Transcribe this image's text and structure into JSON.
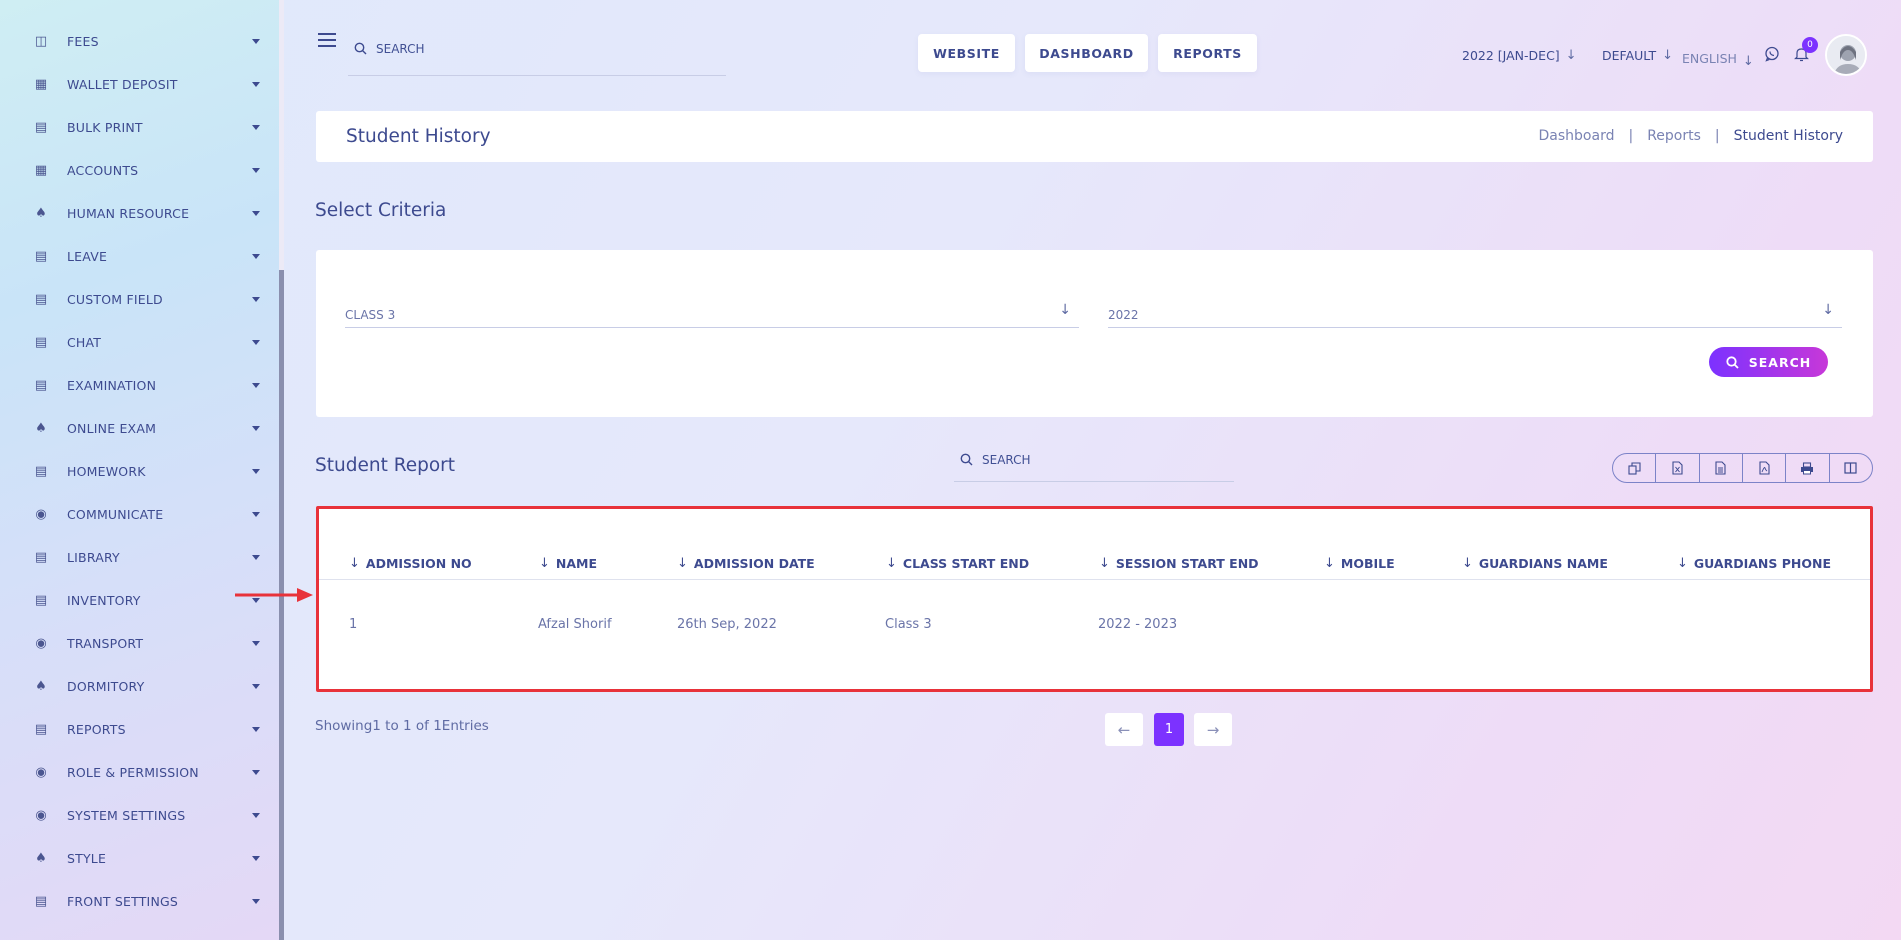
{
  "sidebar": {
    "items": [
      {
        "label": "FEES"
      },
      {
        "label": "WALLET DEPOSIT"
      },
      {
        "label": "BULK PRINT"
      },
      {
        "label": "ACCOUNTS"
      },
      {
        "label": "HUMAN RESOURCE"
      },
      {
        "label": "LEAVE"
      },
      {
        "label": "CUSTOM FIELD"
      },
      {
        "label": "CHAT"
      },
      {
        "label": "EXAMINATION"
      },
      {
        "label": "ONLINE EXAM"
      },
      {
        "label": "HOMEWORK"
      },
      {
        "label": "COMMUNICATE"
      },
      {
        "label": "LIBRARY"
      },
      {
        "label": "INVENTORY"
      },
      {
        "label": "TRANSPORT"
      },
      {
        "label": "DORMITORY"
      },
      {
        "label": "REPORTS"
      },
      {
        "label": "ROLE & PERMISSION"
      },
      {
        "label": "SYSTEM SETTINGS"
      },
      {
        "label": "STYLE"
      },
      {
        "label": "FRONT SETTINGS"
      }
    ]
  },
  "topbar": {
    "search_placeholder": "SEARCH",
    "buttons": {
      "website": "WEBSITE",
      "dashboard": "DASHBOARD",
      "reports": "REPORTS"
    },
    "session": "2022 [JAN-DEC]",
    "theme": "DEFAULT",
    "language": "ENGLISH",
    "notification_count": "0"
  },
  "page": {
    "title": "Student History",
    "breadcrumb": [
      "Dashboard",
      "Reports",
      "Student History"
    ],
    "breadcrumb_sep": "|"
  },
  "criteria": {
    "title": "Select Criteria",
    "class_value": "CLASS 3",
    "year_value": "2022",
    "search_label": "SEARCH"
  },
  "report": {
    "title": "Student Report",
    "search_placeholder": "SEARCH",
    "columns": [
      "ADMISSION NO",
      "NAME",
      "ADMISSION DATE",
      "CLASS START END",
      "SESSION START END",
      "MOBILE",
      "GUARDIANS NAME",
      "GUARDIANS PHONE"
    ],
    "rows": [
      [
        "1",
        "Afzal Shorif",
        "26th Sep, 2022",
        "Class 3",
        "2022 - 2023",
        "",
        "",
        ""
      ]
    ],
    "showing": "Showing1 to 1 of 1Entries",
    "current_page": "1"
  },
  "colors": {
    "accent": "#7c32ff",
    "accent2": "#c738d8",
    "text": "#3d4a8f",
    "highlight": "#e8323a"
  }
}
